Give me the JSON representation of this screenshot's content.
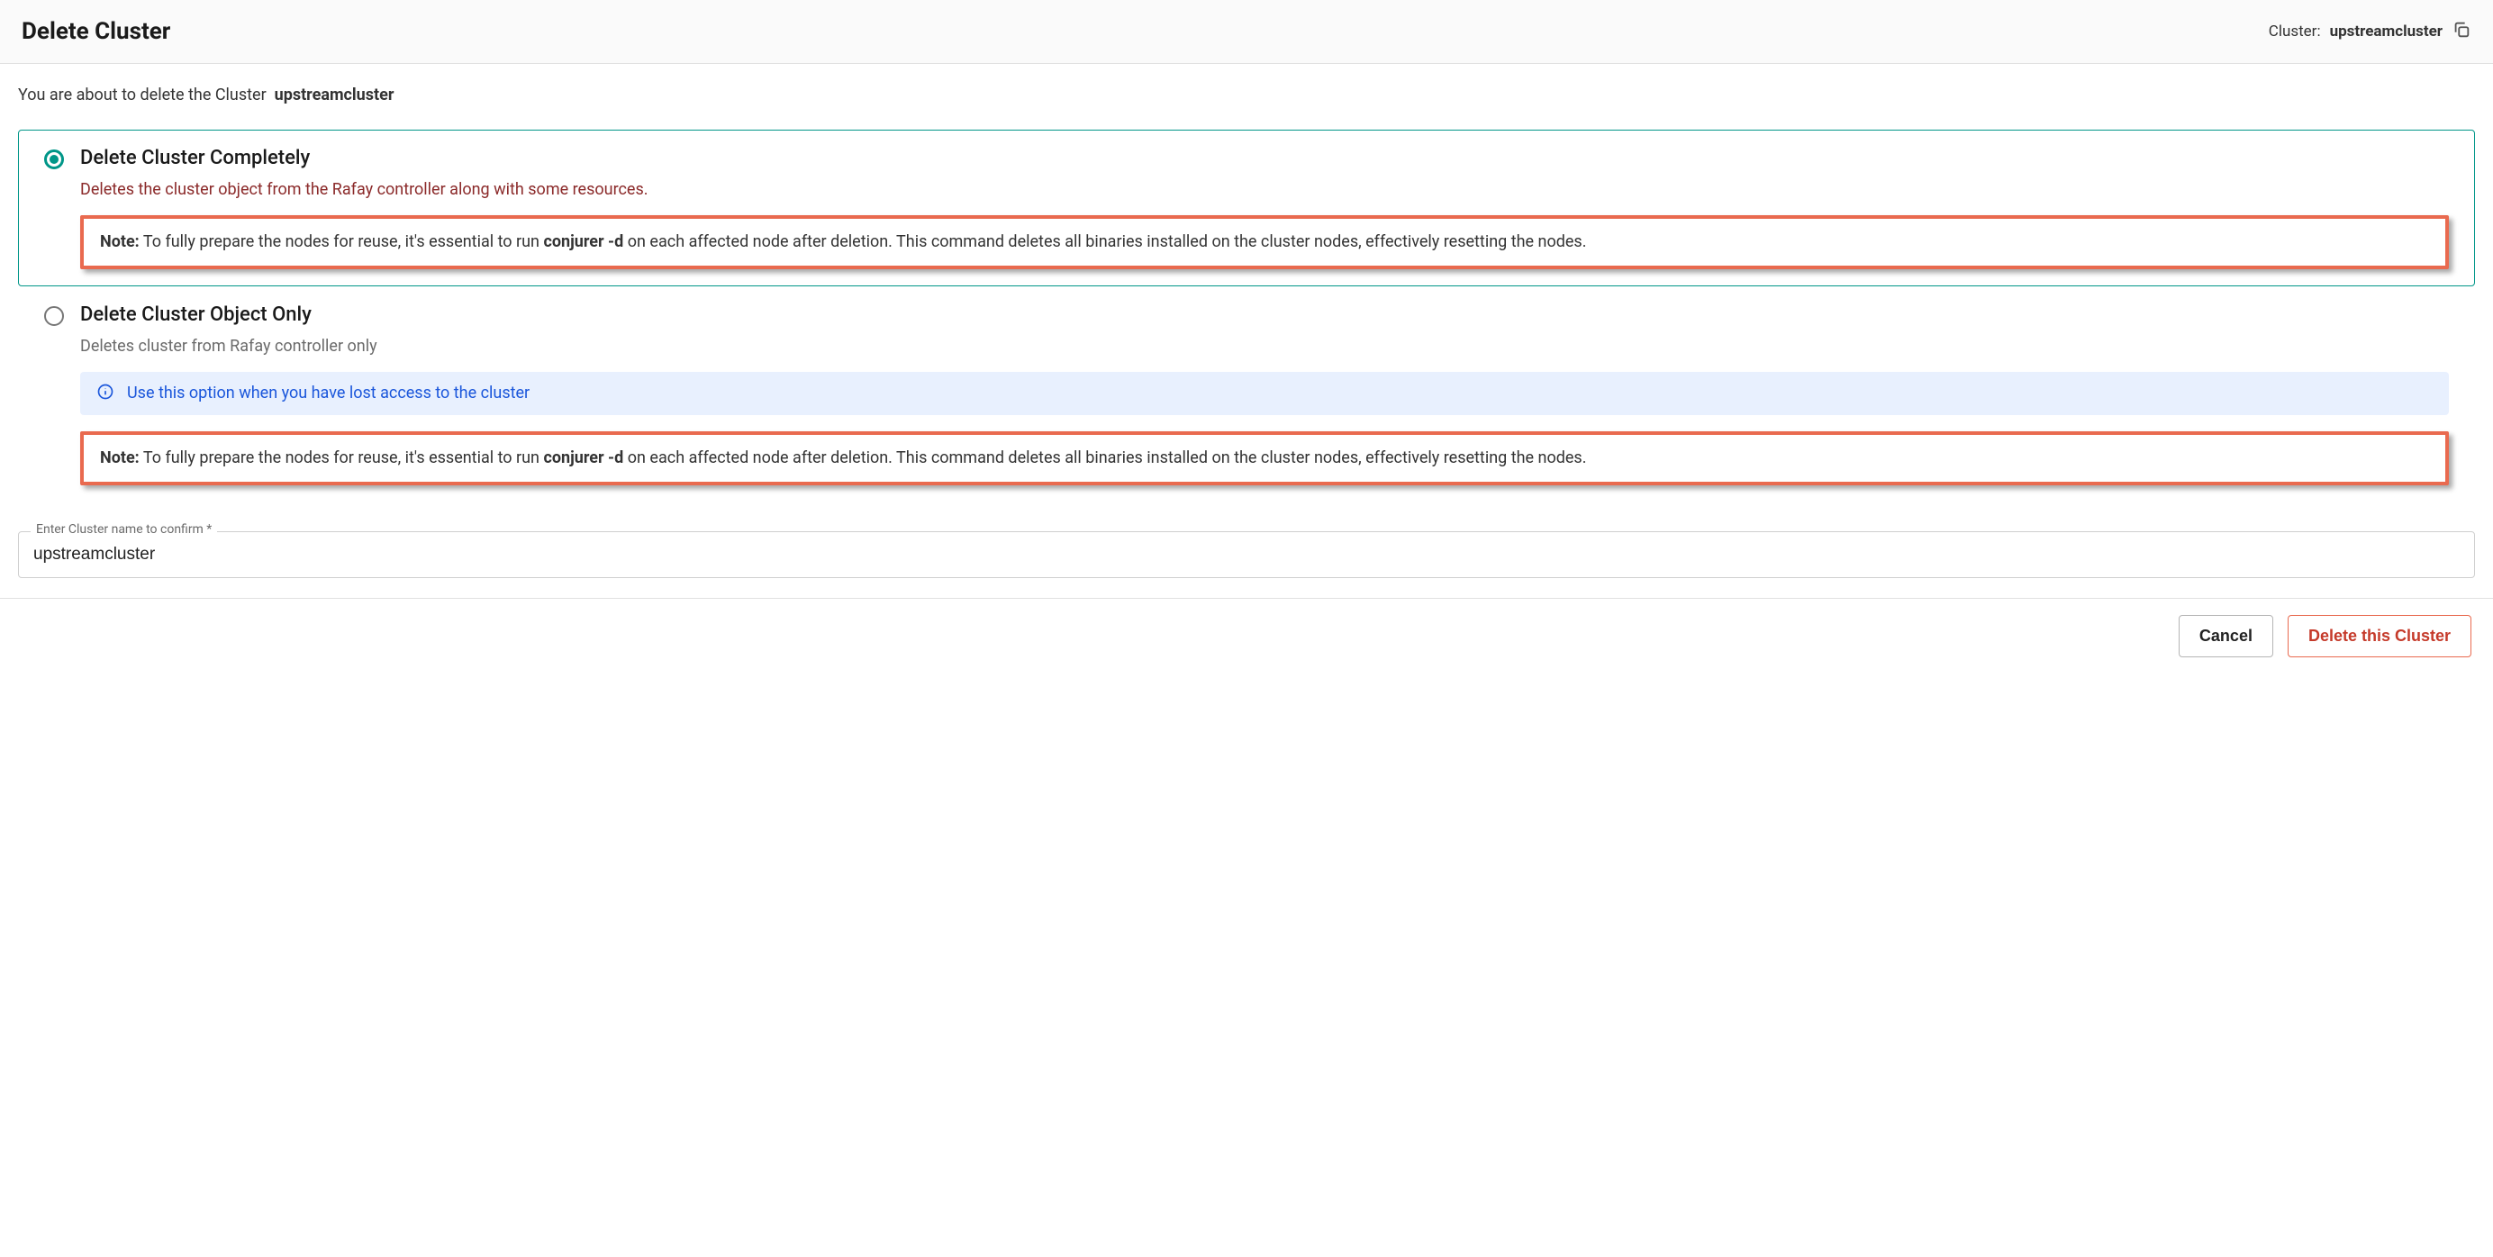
{
  "header": {
    "title": "Delete Cluster",
    "cluster_label": "Cluster:",
    "cluster_name": "upstreamcluster"
  },
  "intro": {
    "prefix": "You are about to delete the Cluster",
    "name": "upstreamcluster"
  },
  "option1": {
    "title": "Delete Cluster Completely",
    "desc": "Deletes the cluster object from the Rafay controller along with some resources.",
    "note_label": "Note:",
    "note_pre": " To fully prepare the nodes for reuse, it's essential to run ",
    "note_cmd": "conjurer -d",
    "note_post": " on each affected node after deletion. This command deletes all binaries installed on the cluster nodes, effectively resetting the nodes."
  },
  "option2": {
    "title": "Delete Cluster Object Only",
    "desc": "Deletes cluster from Rafay controller only",
    "info": "Use this option when you have lost access to the cluster",
    "note_label": "Note:",
    "note_pre": " To fully prepare the nodes for reuse, it's essential to run ",
    "note_cmd": "conjurer -d",
    "note_post": " on each affected node after deletion. This command deletes all binaries installed on the cluster nodes, effectively resetting the nodes."
  },
  "confirm": {
    "label": "Enter Cluster name to confirm *",
    "value": "upstreamcluster"
  },
  "footer": {
    "cancel": "Cancel",
    "delete": "Delete this Cluster"
  }
}
